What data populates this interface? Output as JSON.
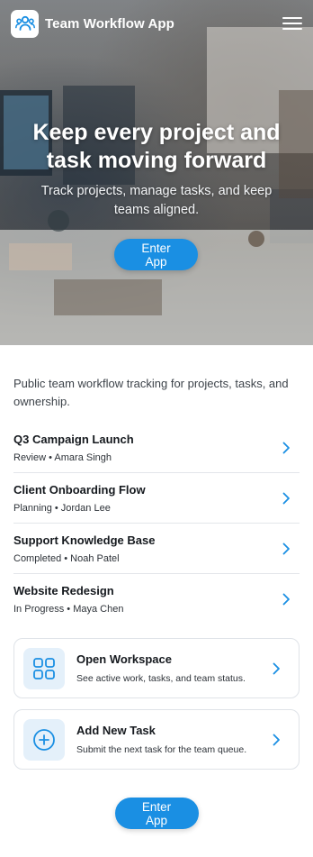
{
  "header": {
    "app_name": "Team Workflow App",
    "logo_icon": "team-people-icon",
    "menu_icon": "hamburger-menu-icon"
  },
  "hero": {
    "title": "Keep every project and task moving forward",
    "subtitle": "Track projects, manage tasks, and keep teams aligned.",
    "cta_label": "Enter App"
  },
  "intro": "Public team workflow tracking for projects, tasks, and ownership.",
  "projects": [
    {
      "title": "Q3 Campaign Launch",
      "meta": "Review • Amara Singh"
    },
    {
      "title": "Client Onboarding Flow",
      "meta": "Planning • Jordan Lee"
    },
    {
      "title": "Support Knowledge Base",
      "meta": "Completed • Noah Patel"
    },
    {
      "title": "Website Redesign",
      "meta": "In Progress • Maya Chen"
    }
  ],
  "cards": [
    {
      "title": "Open Workspace",
      "description": "See active work, tasks, and team status.",
      "icon": "grid-icon"
    },
    {
      "title": "Add New Task",
      "description": "Submit the next task for the team queue.",
      "icon": "plus-circle-icon"
    }
  ],
  "footer": {
    "cta_label": "Enter App"
  },
  "colors": {
    "accent": "#1a8fe3",
    "icon_bg": "#e4f0fa",
    "border": "#dfe3e8"
  }
}
